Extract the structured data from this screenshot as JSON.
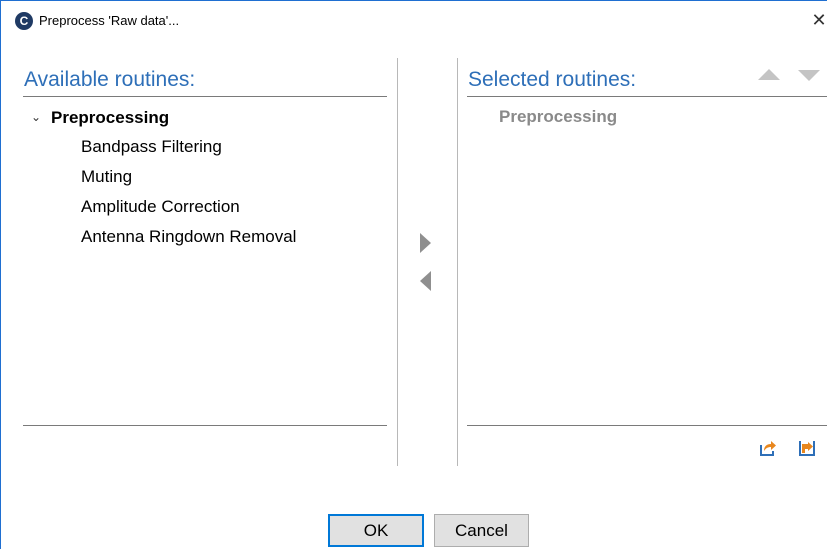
{
  "window": {
    "title": "Preprocess 'Raw data'...",
    "app_icon_glyph": "C",
    "close_glyph": "✕"
  },
  "available": {
    "heading": "Available routines:",
    "group": {
      "chevron": "⌄",
      "label": "Preprocessing"
    },
    "items": [
      {
        "label": "Bandpass Filtering"
      },
      {
        "label": "Muting"
      },
      {
        "label": "Amplitude Correction"
      },
      {
        "label": "Antenna Ringdown Removal"
      }
    ]
  },
  "selected": {
    "heading": "Selected routines:",
    "group": {
      "label": "Preprocessing"
    }
  },
  "icons": {
    "add": "arrow-right-icon",
    "remove": "arrow-left-icon",
    "move_up": "triangle-up-icon",
    "move_down": "triangle-down-icon",
    "export": "export-icon",
    "import": "import-icon"
  },
  "colors": {
    "heading": "#2e6fb8",
    "accent_orange": "#e8871e",
    "focus": "#0078d7"
  },
  "buttons": {
    "ok": "OK",
    "cancel": "Cancel"
  }
}
